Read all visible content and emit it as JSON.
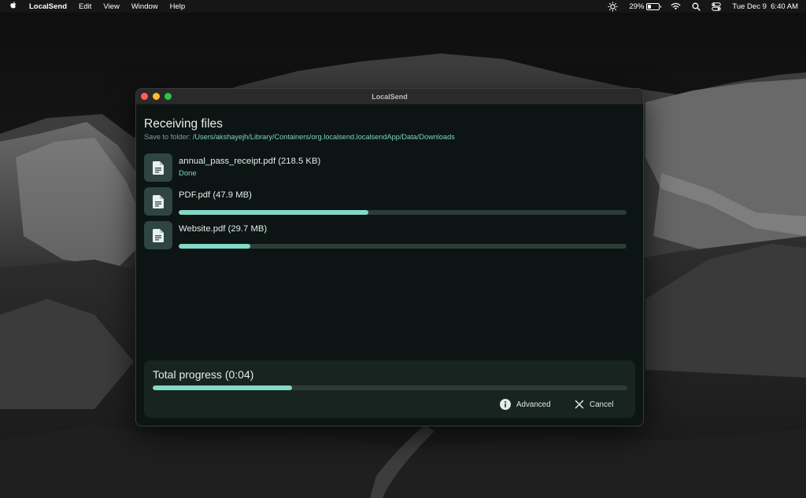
{
  "menubar": {
    "app_name": "LocalSend",
    "menus": [
      "Edit",
      "View",
      "Window",
      "Help"
    ],
    "battery_percent": "29%",
    "battery_level": 0.29,
    "datetime": "Tue Dec 9  6:40 AM",
    "icons": [
      "apple-icon",
      "brightness-icon",
      "battery-icon",
      "wifi-icon",
      "search-icon",
      "control-center-icon"
    ]
  },
  "window": {
    "title": "LocalSend",
    "heading": "Receiving files",
    "save_label": "Save to folder:",
    "save_path": "/Users/akshayejh/Library/Containers/org.localsend.localsendApp/Data/Downloads",
    "files": [
      {
        "name": "annual_pass_receipt.pdf (218.5 KB)",
        "status": "Done",
        "progress": 1.0
      },
      {
        "name": "PDF.pdf (47.9 MB)",
        "status": "",
        "progress": 0.424
      },
      {
        "name": "Website.pdf (29.7 MB)",
        "status": "",
        "progress": 0.16
      }
    ],
    "total_label": "Total progress (0:04)",
    "total_progress": 0.294,
    "advanced_label": "Advanced",
    "cancel_label": "Cancel",
    "accent_color": "#82d9c7"
  }
}
